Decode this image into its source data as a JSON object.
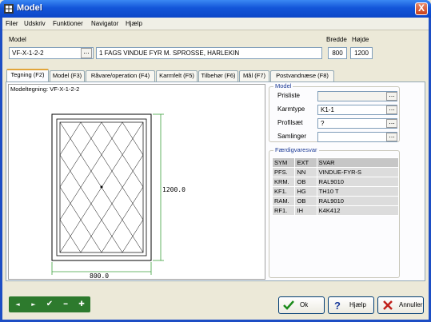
{
  "window": {
    "title": "Model",
    "close_glyph": "X"
  },
  "menu": [
    {
      "label": "Filer",
      "u": "F"
    },
    {
      "label": "Udskriv",
      "u": "U"
    },
    {
      "label": "Funktioner",
      "u": "u"
    },
    {
      "label": "Navigator",
      "u": "N"
    },
    {
      "label": "Hjælp",
      "u": "H"
    }
  ],
  "header": {
    "model_label": "Model",
    "model_code": "VF-X-1-2-2",
    "model_desc": "1 FAGS VINDUE FYR M. SPROSSE, HARLEKIN",
    "width_label": "Bredde",
    "height_label": "Højde",
    "width_value": "800",
    "height_value": "1200",
    "lookup_glyph": "..."
  },
  "tabs": [
    "Tegning (F2)",
    "Model (F3)",
    "Råvare/operation (F4)",
    "Karmfelt (F5)",
    "Tilbehør (F6)",
    "Mål (F7)",
    "Postvandnæse (F8)"
  ],
  "active_tab": 0,
  "drawing": {
    "caption": "Modeltegning: VF-X-1-2-2",
    "width_dim": "800.0",
    "height_dim": "1200.0",
    "dim_color": "#3ca03c"
  },
  "model_group": {
    "title": "Model",
    "rows": [
      {
        "label": "Prisliste",
        "value": ""
      },
      {
        "label": "Karmtype",
        "value": "K1-1"
      },
      {
        "label": "Profilsæt",
        "value": "?"
      },
      {
        "label": "Samlinger",
        "value": ""
      }
    ]
  },
  "answers": {
    "title": "Færdigvaresvar",
    "columns": [
      "SYM",
      "EXT",
      "SVAR"
    ],
    "rows": [
      [
        "PFS.",
        "NN",
        "VINDUE-FYR-S"
      ],
      [
        "KRM.",
        "OB",
        "RAL9010"
      ],
      [
        "KF1.",
        "HG",
        "TH10 T"
      ],
      [
        "RAM.",
        "OB",
        "RAL9010"
      ],
      [
        "RF1.",
        "IH",
        "K4K412"
      ]
    ]
  },
  "navigator": {
    "buttons": [
      {
        "name": "nav-prev-icon",
        "glyph": "◄"
      },
      {
        "name": "nav-next-icon",
        "glyph": "►"
      },
      {
        "name": "nav-confirm-icon",
        "glyph": "✔"
      },
      {
        "name": "nav-remove-icon",
        "glyph": "━"
      },
      {
        "name": "nav-add-icon",
        "glyph": "✚"
      }
    ],
    "color": "#2d7a2d"
  },
  "actions": {
    "ok": "Ok",
    "help": "Hjælp",
    "cancel": "Annuller"
  }
}
